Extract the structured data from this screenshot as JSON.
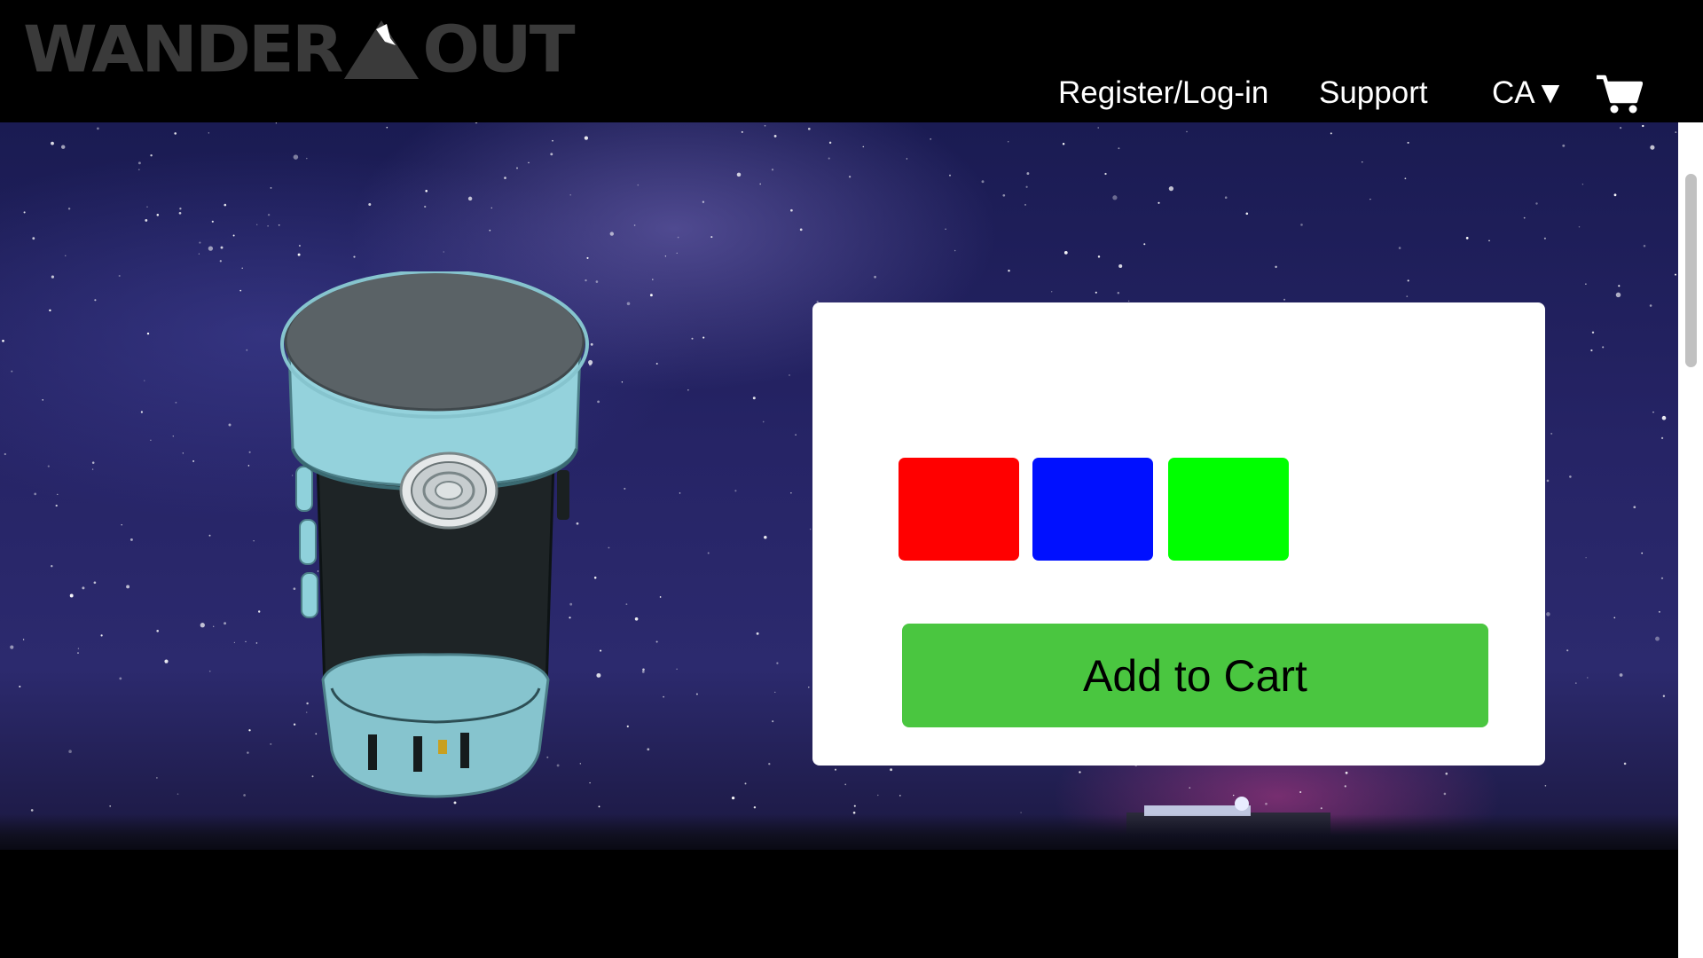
{
  "header": {
    "logo_left": "WANDER",
    "logo_right": "OUT",
    "nav": {
      "register_label": "Register/Log-in",
      "support_label": "Support",
      "region_label": "CA▼"
    },
    "cart_icon": "shopping-cart-icon"
  },
  "product": {
    "image": "cylindrical-lantern-3d-model",
    "color_options": [
      {
        "name": "red",
        "color": "#ff0000"
      },
      {
        "name": "blue",
        "color": "#0010ff"
      },
      {
        "name": "green",
        "color": "#00ff00"
      }
    ],
    "add_to_cart_label": "Add to Cart",
    "add_to_cart_color": "#4ac640"
  },
  "background": {
    "theme": "night-sky-milky-way"
  }
}
